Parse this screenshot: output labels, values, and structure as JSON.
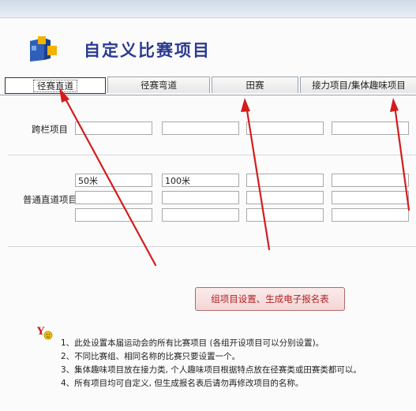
{
  "page_title": "自定义比赛项目",
  "tabs": [
    {
      "label": "径赛直道",
      "active": true
    },
    {
      "label": "径赛弯道",
      "active": false
    },
    {
      "label": "田赛",
      "active": false
    },
    {
      "label": "接力项目/集体趣味项目",
      "active": false
    }
  ],
  "hurdles": {
    "label": "跨栏项目",
    "values": [
      "",
      "",
      "",
      ""
    ]
  },
  "straight": {
    "label": "普通直道项目",
    "rows": [
      [
        "50米",
        "100米",
        "",
        ""
      ],
      [
        "",
        "",
        "",
        ""
      ],
      [
        "",
        "",
        "",
        ""
      ]
    ]
  },
  "generate_button": "组项目设置、生成电子报名表",
  "hint_icon": "yo-hint-icon",
  "notes": [
    "1、此处设置本届运动会的所有比赛项目 (各组开设项目可以分别设置)。",
    "2、不同比赛组、相同名称的比赛只要设置一个。",
    "3、集体趣味项目放在接力类, 个人趣味项目根据特点放在径赛类或田赛类都可以。",
    "4、所有项目均可自定义, 但生成报名表后请勿再修改项目的名称。"
  ],
  "colors": {
    "title": "#2b3a8f",
    "button_text": "#b02020",
    "arrow": "#d51c1c"
  }
}
